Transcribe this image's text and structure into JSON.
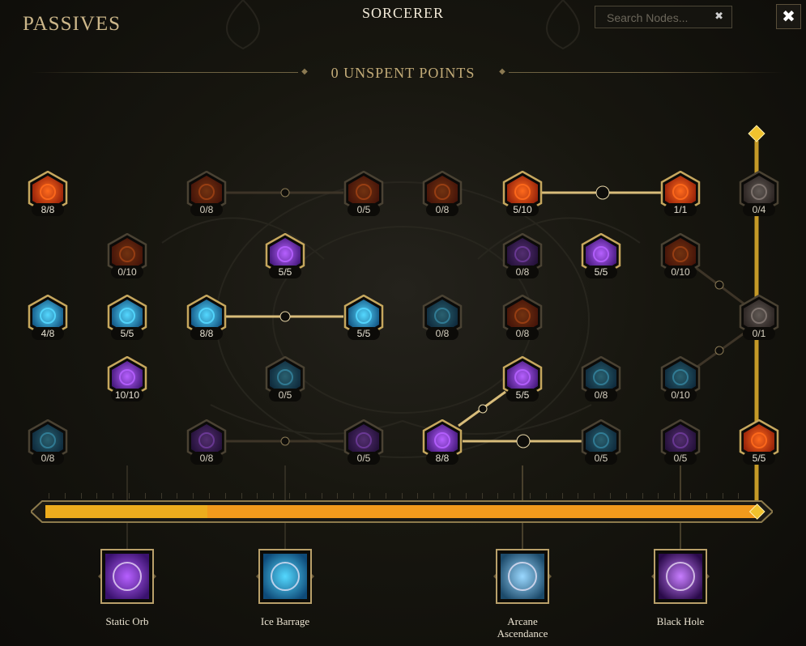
{
  "header": {
    "section_title": "PASSIVES",
    "class_name": "SORCERER",
    "search_placeholder": "Search Nodes...",
    "search_value": "",
    "search_clear_glyph": "✖",
    "close_glyph": "✖",
    "points_text": "0 UNSPENT POINTS"
  },
  "progress": {
    "fraction": 1.0,
    "color": "#f29a1c"
  },
  "colors": {
    "accent_gold": "#c6a75e",
    "fire": "#d8401a",
    "ice": "#38b5e8",
    "arcane": "#8a3ad8"
  },
  "nodes": [
    {
      "id": "fire-1",
      "label": "8/8",
      "theme": "fire",
      "active": true,
      "icon": "fire-burst-icon"
    },
    {
      "id": "fire-2",
      "label": "0/8",
      "theme": "fire",
      "active": false,
      "icon": "ember-icon"
    },
    {
      "id": "fire-3",
      "label": "0/5",
      "theme": "fire",
      "active": false,
      "icon": "flame-cloud-icon"
    },
    {
      "id": "fire-4",
      "label": "0/8",
      "theme": "fire",
      "active": false,
      "icon": "lava-icon"
    },
    {
      "id": "fire-5",
      "label": "5/10",
      "theme": "fire",
      "active": true,
      "icon": "fire-orb-icon"
    },
    {
      "id": "fire-6",
      "label": "1/1",
      "theme": "fire",
      "active": true,
      "icon": "fire-mask-icon"
    },
    {
      "id": "gen-1",
      "label": "0/4",
      "theme": "neutral",
      "active": false,
      "icon": "rune-icon"
    },
    {
      "id": "fire-7",
      "label": "0/10",
      "theme": "fire",
      "active": false,
      "icon": "fist-icon"
    },
    {
      "id": "arc-1",
      "label": "5/5",
      "theme": "arcane",
      "active": true,
      "icon": "mana-orb-icon"
    },
    {
      "id": "arc-2",
      "label": "0/8",
      "theme": "arcane",
      "active": false,
      "icon": "void-eye-icon"
    },
    {
      "id": "arc-3",
      "label": "5/5",
      "theme": "arcane",
      "active": true,
      "icon": "arcane-spike-icon"
    },
    {
      "id": "fire-8",
      "label": "0/10",
      "theme": "fire",
      "active": false,
      "icon": "dark-flame-icon"
    },
    {
      "id": "ice-1",
      "label": "4/8",
      "theme": "ice",
      "active": true,
      "icon": "ice-crest-icon"
    },
    {
      "id": "ice-2",
      "label": "5/5",
      "theme": "ice",
      "active": true,
      "icon": "ice-pillar-icon"
    },
    {
      "id": "ice-3",
      "label": "8/8",
      "theme": "ice",
      "active": true,
      "icon": "ice-shards-icon"
    },
    {
      "id": "ice-4",
      "label": "5/5",
      "theme": "ice",
      "active": true,
      "icon": "frost-nova-icon"
    },
    {
      "id": "ice-5",
      "label": "0/8",
      "theme": "ice",
      "active": false,
      "icon": "ice-claw-icon"
    },
    {
      "id": "gen-2",
      "label": "0/8",
      "theme": "fire",
      "active": false,
      "icon": "cross-shield-icon"
    },
    {
      "id": "gen-3",
      "label": "0/1",
      "theme": "neutral",
      "active": false,
      "icon": "wing-icon"
    },
    {
      "id": "arc-4",
      "label": "10/10",
      "theme": "arcane",
      "active": true,
      "icon": "lightning-orb-icon"
    },
    {
      "id": "ice-6",
      "label": "0/5",
      "theme": "ice",
      "active": false,
      "icon": "ice-block-icon"
    },
    {
      "id": "arc-5",
      "label": "5/5",
      "theme": "arcane",
      "active": true,
      "icon": "arcane-ring-icon"
    },
    {
      "id": "ice-7",
      "label": "0/8",
      "theme": "ice",
      "active": false,
      "icon": "ice-spear-icon"
    },
    {
      "id": "ice-8",
      "label": "0/10",
      "theme": "ice",
      "active": false,
      "icon": "ice-vortex-icon"
    },
    {
      "id": "ice-9",
      "label": "0/8",
      "theme": "ice",
      "active": false,
      "icon": "frost-ghost-icon"
    },
    {
      "id": "arc-6",
      "label": "0/8",
      "theme": "arcane",
      "active": false,
      "icon": "chain-lightning-icon"
    },
    {
      "id": "arc-7",
      "label": "0/5",
      "theme": "arcane",
      "active": false,
      "icon": "storm-icon"
    },
    {
      "id": "arc-8",
      "label": "8/8",
      "theme": "arcane",
      "active": true,
      "icon": "thunder-icon"
    },
    {
      "id": "ice-10",
      "label": "0/5",
      "theme": "ice",
      "active": false,
      "icon": "snowflake-icon"
    },
    {
      "id": "arc-9",
      "label": "0/5",
      "theme": "arcane",
      "active": false,
      "icon": "spark-icon"
    },
    {
      "id": "fire-9",
      "label": "5/5",
      "theme": "fire",
      "active": true,
      "icon": "inferno-icon"
    }
  ],
  "skills": [
    {
      "id": "static-orb",
      "label": "Static Orb",
      "theme": "arcane",
      "icon": "static-orb-icon"
    },
    {
      "id": "ice-barrage",
      "label": "Ice Barrage",
      "theme": "ice",
      "icon": "ice-barrage-icon"
    },
    {
      "id": "arcane-ascendance",
      "label": "Arcane Ascendance",
      "theme": "portrait",
      "icon": "arcane-ascendance-icon"
    },
    {
      "id": "black-hole",
      "label": "Black Hole",
      "theme": "void",
      "icon": "black-hole-icon"
    }
  ]
}
